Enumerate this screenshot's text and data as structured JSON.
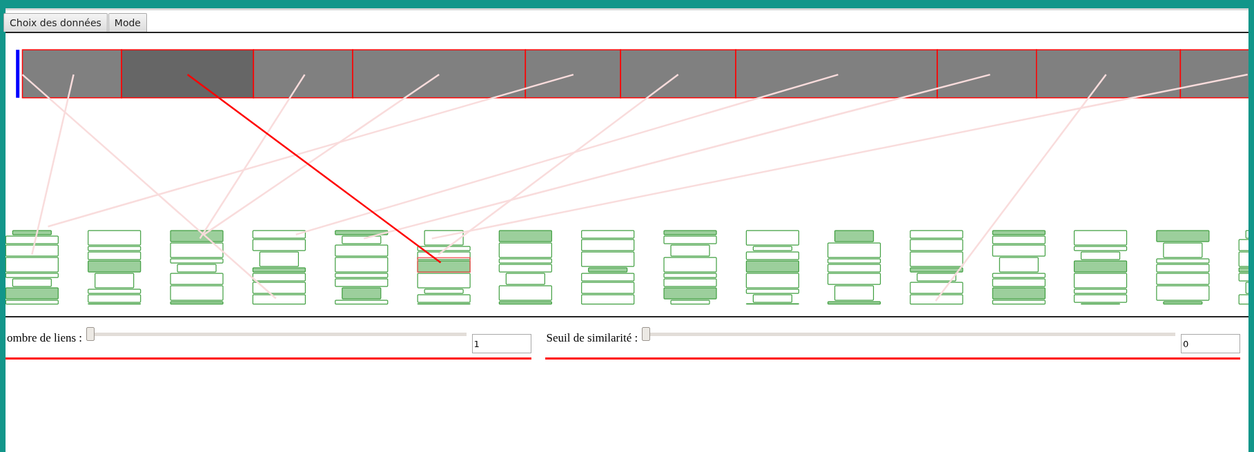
{
  "tabs": [
    {
      "label": "Choix des données",
      "selected": false
    },
    {
      "label": "Mode",
      "selected": false
    }
  ],
  "timeline": {
    "segments": [
      {
        "selected": false
      },
      {
        "selected": true
      },
      {
        "selected": false
      },
      {
        "selected": false
      },
      {
        "selected": false
      },
      {
        "selected": false
      },
      {
        "selected": false
      },
      {
        "selected": false
      },
      {
        "selected": false
      },
      {
        "selected": false
      }
    ]
  },
  "controls": [
    {
      "label": "ombre de liens :",
      "level": 0,
      "value": "1"
    },
    {
      "label": "Seuil de similarité :",
      "level": 0,
      "value": "0"
    }
  ]
}
